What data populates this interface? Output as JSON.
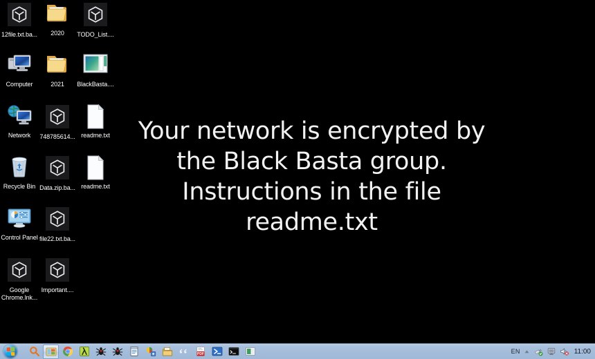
{
  "desktop": {
    "background_color": "#000000",
    "icons": [
      {
        "label": "12file.txt.ba...",
        "icon": "encrypted-file-cube-icon",
        "type": "encrypted",
        "col": 0,
        "row": 0
      },
      {
        "label": "2020",
        "icon": "folder-icon",
        "type": "folder",
        "col": 1,
        "row": 0
      },
      {
        "label": "TODO_List....",
        "icon": "encrypted-file-cube-icon",
        "type": "encrypted",
        "col": 2,
        "row": 0
      },
      {
        "label": "Computer",
        "icon": "computer-icon",
        "type": "system",
        "col": 0,
        "row": 1
      },
      {
        "label": "2021",
        "icon": "folder-icon",
        "type": "folder",
        "col": 1,
        "row": 1
      },
      {
        "label": "BlackBasta....",
        "icon": "picture-file-icon",
        "type": "image",
        "col": 2,
        "row": 1
      },
      {
        "label": "Network",
        "icon": "network-icon",
        "type": "system",
        "col": 0,
        "row": 2
      },
      {
        "label": "748785614...",
        "icon": "encrypted-file-cube-icon",
        "type": "encrypted",
        "col": 1,
        "row": 2
      },
      {
        "label": "readme.txt",
        "icon": "text-document-icon",
        "type": "document",
        "col": 2,
        "row": 2
      },
      {
        "label": "Recycle Bin",
        "icon": "recycle-bin-icon",
        "type": "system",
        "col": 0,
        "row": 3
      },
      {
        "label": "Data.zip.ba...",
        "icon": "encrypted-file-cube-icon",
        "type": "encrypted",
        "col": 1,
        "row": 3
      },
      {
        "label": "readme.txt",
        "icon": "text-document-icon",
        "type": "document",
        "col": 2,
        "row": 3
      },
      {
        "label": "Control Panel",
        "icon": "control-panel-icon",
        "type": "system",
        "col": 0,
        "row": 4
      },
      {
        "label": "file22.txt.ba...",
        "icon": "encrypted-file-cube-icon",
        "type": "encrypted",
        "col": 1,
        "row": 4
      },
      {
        "label": "Google Chrome.lnk...",
        "icon": "encrypted-file-cube-icon",
        "type": "encrypted",
        "col": 0,
        "row": 5
      },
      {
        "label": "Important....",
        "icon": "encrypted-file-cube-icon",
        "type": "encrypted",
        "col": 1,
        "row": 5
      }
    ]
  },
  "ransom_note": {
    "lines": [
      "Your network is encrypted by",
      "the Black Basta group.",
      "Instructions in the file",
      "readme.txt"
    ],
    "text_color": "#f2f2f2"
  },
  "taskbar": {
    "background_color": "#a9c1dd",
    "start_button": {
      "name": "Start",
      "icon": "windows-orb-icon"
    },
    "buttons": [
      {
        "icon": "search-magnifier-icon",
        "label": "Search",
        "active": false
      },
      {
        "icon": "folder-window-icon",
        "label": "Windows Explorer",
        "active": true
      },
      {
        "icon": "chrome-icon",
        "label": "Google Chrome",
        "active": false
      },
      {
        "icon": "lambda-app-icon",
        "label": "Lambda",
        "active": false
      },
      {
        "icon": "bug-icon",
        "label": "Debugger",
        "active": false
      },
      {
        "icon": "bug-icon",
        "label": "Debugger",
        "active": false
      },
      {
        "icon": "notepad-icon",
        "label": "Notepad",
        "active": false
      },
      {
        "icon": "app-colorful-icon",
        "label": "Application",
        "active": false
      },
      {
        "icon": "archive-icon",
        "label": "Archive Manager",
        "active": false
      },
      {
        "icon": "quotes-icon",
        "label": "Quotes App",
        "active": false
      },
      {
        "icon": "pdf-icon",
        "label": "PDF Reader",
        "active": false
      },
      {
        "icon": "powershell-icon",
        "label": "Windows PowerShell",
        "active": false
      },
      {
        "icon": "command-prompt-icon",
        "label": "Command Prompt",
        "active": false
      },
      {
        "icon": "green-app-icon",
        "label": "Application",
        "active": false
      }
    ],
    "tray": {
      "language": "EN",
      "show_hidden_icons": "show-hidden-icons-chevron",
      "icons": [
        {
          "icon": "flash-drive-icon",
          "label": "Safely Remove Hardware"
        },
        {
          "icon": "network-monitor-icon",
          "label": "Network"
        },
        {
          "icon": "volume-muted-icon",
          "label": "Volume"
        }
      ],
      "clock": "11:00"
    }
  }
}
